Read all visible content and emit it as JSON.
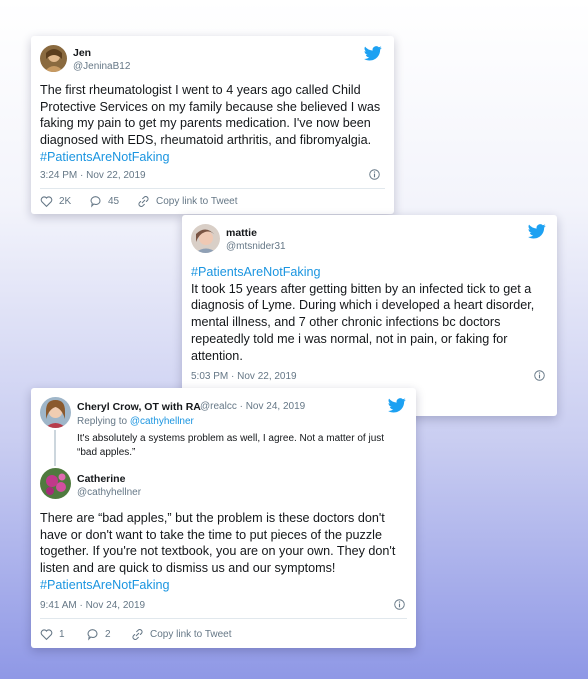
{
  "tweet1": {
    "name": "Jen",
    "handle": "@JeninaB12",
    "text": "The first rheumatologist I went to 4 years ago called Child Protective Services on my family because she believed I was faking my pain to get my parents medication. I've now been diagnosed with EDS, rheumatoid arthritis, and fibromyalgia.",
    "hashtag": "#PatientsAreNotFaking",
    "timestamp": "3:24 PM · Nov 22, 2019",
    "likes": "2K",
    "replies": "45",
    "copy_link": "Copy link to Tweet"
  },
  "tweet2": {
    "name": "mattie",
    "handle": "@mtsnider31",
    "hashtag": "#PatientsAreNotFaking",
    "text": "It took 15 years after getting bitten by an infected tick to get a diagnosis of Lyme. During which i developed a heart disorder, mental illness, and 7 other chronic infections bc doctors repeatedly told me i was normal, not in pain, or faking for attention.",
    "timestamp": "5:03 PM · Nov 22, 2019"
  },
  "tweet3": {
    "parent": {
      "name": "Cheryl Crow, OT with RA",
      "handle_date": "@realcc · Nov 24, 2019",
      "replying_prefix": "Replying to",
      "replying_handle": "@cathyhellner",
      "text": "It's absolutely a systems problem as well, I agree. Not a matter of just “bad apples.”"
    },
    "name": "Catherine",
    "handle": "@cathyhellner",
    "text": "There are “bad apples,” but the problem is these doctors don't have or don't want to take the time to put pieces of the puzzle together. If you're not textbook, you are on your own.  They don't listen and are quick to dismiss us and our symptoms!",
    "hashtag": "#PatientsAreNotFaking",
    "timestamp": "9:41 AM · Nov 24, 2019",
    "likes": "1",
    "replies": "2",
    "copy_link": "Copy link to Tweet"
  },
  "colors": {
    "link": "#1b95e0",
    "muted": "#657786",
    "twitter_blue": "#1da1f2"
  }
}
